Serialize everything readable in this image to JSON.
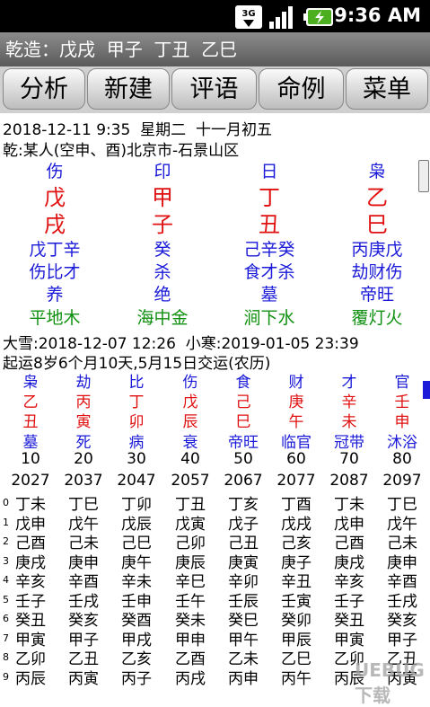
{
  "status": {
    "time": "9:36 AM",
    "network": "3G"
  },
  "title": "乾造：戊戌  甲子  丁丑  乙巳",
  "tabs": [
    "分析",
    "新建",
    "评语",
    "命例",
    "菜单"
  ],
  "info": {
    "line1": "2018-12-11 9:35  星期二  十一月初五",
    "line2": "乾:某人(空申、酉)北京市-石景山区"
  },
  "pillars": [
    {
      "shishen": "伤",
      "gan": "戊",
      "zhi": "戌",
      "canggan": "戊丁辛",
      "cang_shishen": "伤比才",
      "state": "养",
      "nayin": "平地木"
    },
    {
      "shishen": "印",
      "gan": "甲",
      "zhi": "子",
      "canggan": "癸",
      "cang_shishen": "杀",
      "state": "绝",
      "nayin": "海中金"
    },
    {
      "shishen": "日",
      "gan": "丁",
      "zhi": "丑",
      "canggan": "己辛癸",
      "cang_shishen": "食才杀",
      "state": "墓",
      "nayin": "涧下水"
    },
    {
      "shishen": "枭",
      "gan": "乙",
      "zhi": "巳",
      "canggan": "丙庚戊",
      "cang_shishen": "劫财伤",
      "state": "帝旺",
      "nayin": "覆灯火"
    }
  ],
  "jieqi": "大雪:2018-12-07 12:26  小寒:2019-01-05 23:39",
  "qiyun": "起运8岁6个月10天,5月15日交运(农历)",
  "dayun": [
    {
      "shishen": "枭",
      "gan": "乙",
      "zhi": "丑",
      "state": "墓",
      "age": "10",
      "year": "2027"
    },
    {
      "shishen": "劫",
      "gan": "丙",
      "zhi": "寅",
      "state": "死",
      "age": "20",
      "year": "2037"
    },
    {
      "shishen": "比",
      "gan": "丁",
      "zhi": "卯",
      "state": "病",
      "age": "30",
      "year": "2047"
    },
    {
      "shishen": "伤",
      "gan": "戊",
      "zhi": "辰",
      "state": "衰",
      "age": "40",
      "year": "2057"
    },
    {
      "shishen": "食",
      "gan": "己",
      "zhi": "巳",
      "state": "帝旺",
      "age": "50",
      "year": "2067"
    },
    {
      "shishen": "财",
      "gan": "庚",
      "zhi": "午",
      "state": "临官",
      "age": "60",
      "year": "2077"
    },
    {
      "shishen": "才",
      "gan": "辛",
      "zhi": "未",
      "state": "冠带",
      "age": "70",
      "year": "2087"
    },
    {
      "shishen": "官",
      "gan": "壬",
      "zhi": "申",
      "state": "沐浴",
      "age": "80",
      "year": "2097"
    }
  ],
  "liunian_index": [
    "0",
    "1",
    "2",
    "3",
    "4",
    "5",
    "6",
    "7",
    "8",
    "9"
  ],
  "liunian": [
    [
      "丁未",
      "丁巳",
      "丁卯",
      "丁丑",
      "丁亥",
      "丁酉",
      "丁未",
      "丁巳"
    ],
    [
      "戊申",
      "戊午",
      "戊辰",
      "戊寅",
      "戊子",
      "戊戌",
      "戊申",
      "戊午"
    ],
    [
      "己酉",
      "己未",
      "己巳",
      "己卯",
      "己丑",
      "己亥",
      "己酉",
      "己未"
    ],
    [
      "庚戌",
      "庚申",
      "庚午",
      "庚辰",
      "庚寅",
      "庚子",
      "庚戌",
      "庚申"
    ],
    [
      "辛亥",
      "辛酉",
      "辛未",
      "辛巳",
      "辛卯",
      "辛丑",
      "辛亥",
      "辛酉"
    ],
    [
      "壬子",
      "壬戌",
      "壬申",
      "壬午",
      "壬辰",
      "壬寅",
      "壬子",
      "壬戌"
    ],
    [
      "癸丑",
      "癸亥",
      "癸酉",
      "癸未",
      "癸巳",
      "癸卯",
      "癸丑",
      "癸亥"
    ],
    [
      "甲寅",
      "甲子",
      "甲戌",
      "甲申",
      "甲午",
      "甲辰",
      "甲寅",
      "甲子"
    ],
    [
      "乙卯",
      "乙丑",
      "乙亥",
      "乙酉",
      "乙未",
      "乙巳",
      "乙卯",
      "乙丑"
    ],
    [
      "丙辰",
      "丙寅",
      "丙子",
      "丙戌",
      "丙申",
      "丙午",
      "丙辰",
      "丙寅"
    ]
  ],
  "watermark": "UEBUG下载"
}
